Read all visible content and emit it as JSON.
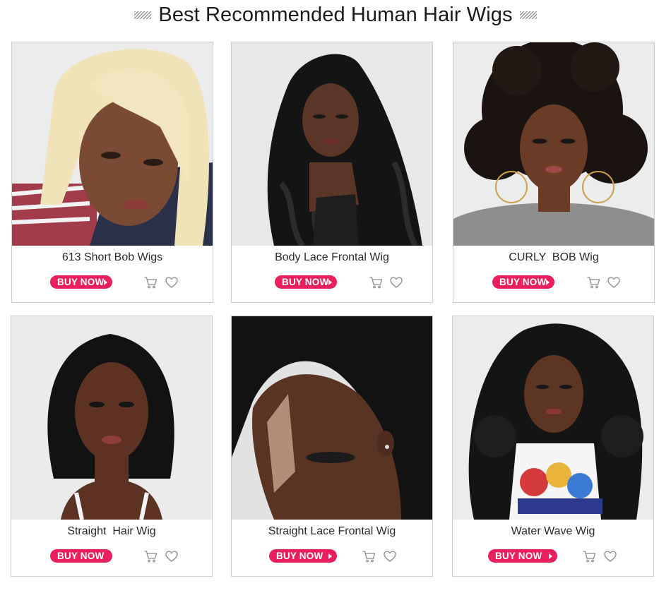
{
  "header": {
    "title": "Best Recommended Human Hair Wigs"
  },
  "colors": {
    "accent": "#ea1f5e",
    "border": "#cfcfcf",
    "icon": "#8a8a8a"
  },
  "products": [
    {
      "name": "613 Short Bob Wigs",
      "buy_label": "BUY NOW",
      "image": "woman with blonde straight bob wig"
    },
    {
      "name": "Body Lace Frontal Wig",
      "buy_label": "BUY NOW",
      "image": "woman with long black body wave wig"
    },
    {
      "name": "CURLY  BOB Wig",
      "buy_label": "BUY NOW",
      "image": "woman with curly black bob wig"
    },
    {
      "name": "Straight  Hair Wig",
      "buy_label": "BUY NOW",
      "image": "woman with black straight bob wig"
    },
    {
      "name": "Straight Lace Frontal Wig",
      "buy_label": "BUY NOW",
      "image": "close-up of straight lace frontal hairline"
    },
    {
      "name": "Water Wave Wig",
      "buy_label": "BUY NOW",
      "image": "woman with long water wave wig"
    }
  ]
}
